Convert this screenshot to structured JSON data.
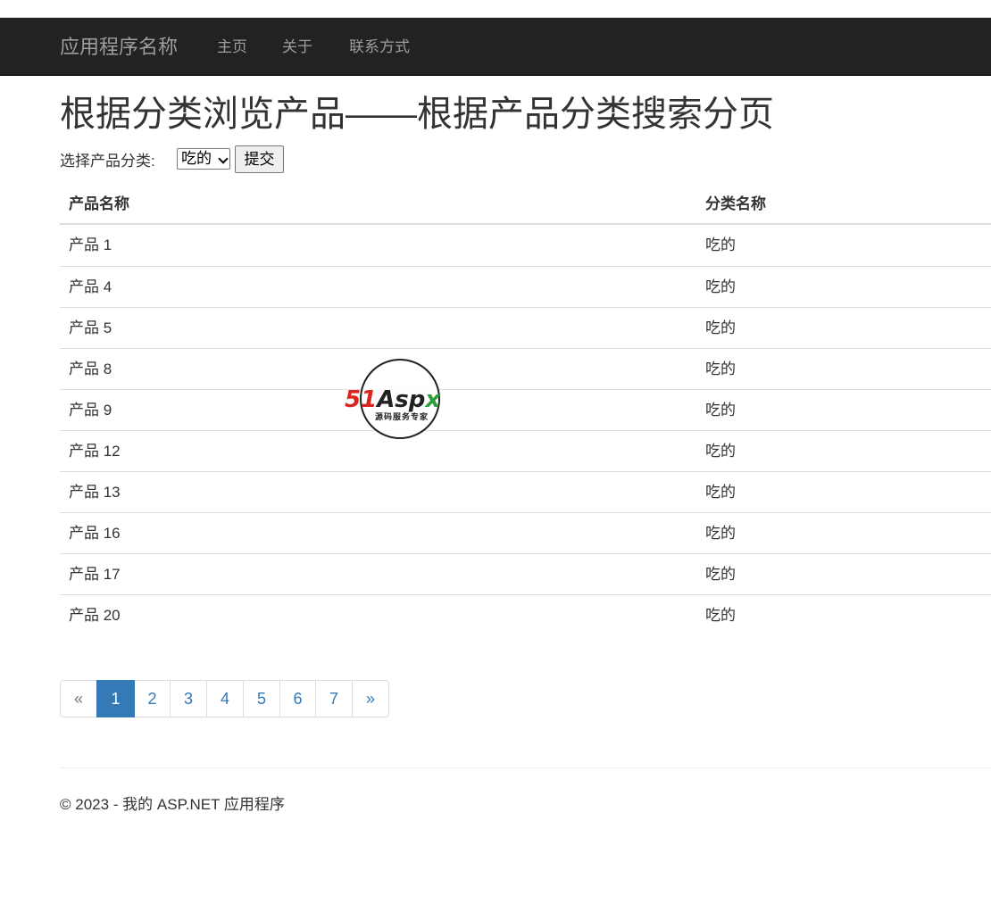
{
  "navbar": {
    "brand": "应用程序名称",
    "links": [
      "主页",
      "关于",
      "联系方式"
    ]
  },
  "page": {
    "title": "根据分类浏览产品——根据产品分类搜索分页"
  },
  "filter": {
    "label": "选择产品分类:",
    "selected": "吃的",
    "submit_label": "提交"
  },
  "table": {
    "headers": [
      "产品名称",
      "分类名称"
    ],
    "rows": [
      [
        "产品 1",
        "吃的"
      ],
      [
        "产品 4",
        "吃的"
      ],
      [
        "产品 5",
        "吃的"
      ],
      [
        "产品 8",
        "吃的"
      ],
      [
        "产品 9",
        "吃的"
      ],
      [
        "产品 12",
        "吃的"
      ],
      [
        "产品 13",
        "吃的"
      ],
      [
        "产品 16",
        "吃的"
      ],
      [
        "产品 17",
        "吃的"
      ],
      [
        "产品 20",
        "吃的"
      ]
    ]
  },
  "pagination": {
    "prev": "«",
    "next": "»",
    "pages": [
      "1",
      "2",
      "3",
      "4",
      "5",
      "6",
      "7"
    ],
    "current": "1"
  },
  "footer": {
    "text": "© 2023 - 我的 ASP.NET 应用程序"
  },
  "watermark": {
    "brand_51": "51",
    "brand_asp": "Asp",
    "brand_x": "x",
    "tagline": "源码服务专家"
  },
  "colors": {
    "navbar_bg": "#222222",
    "link": "#337ab7",
    "active_page": "#337ab7"
  }
}
